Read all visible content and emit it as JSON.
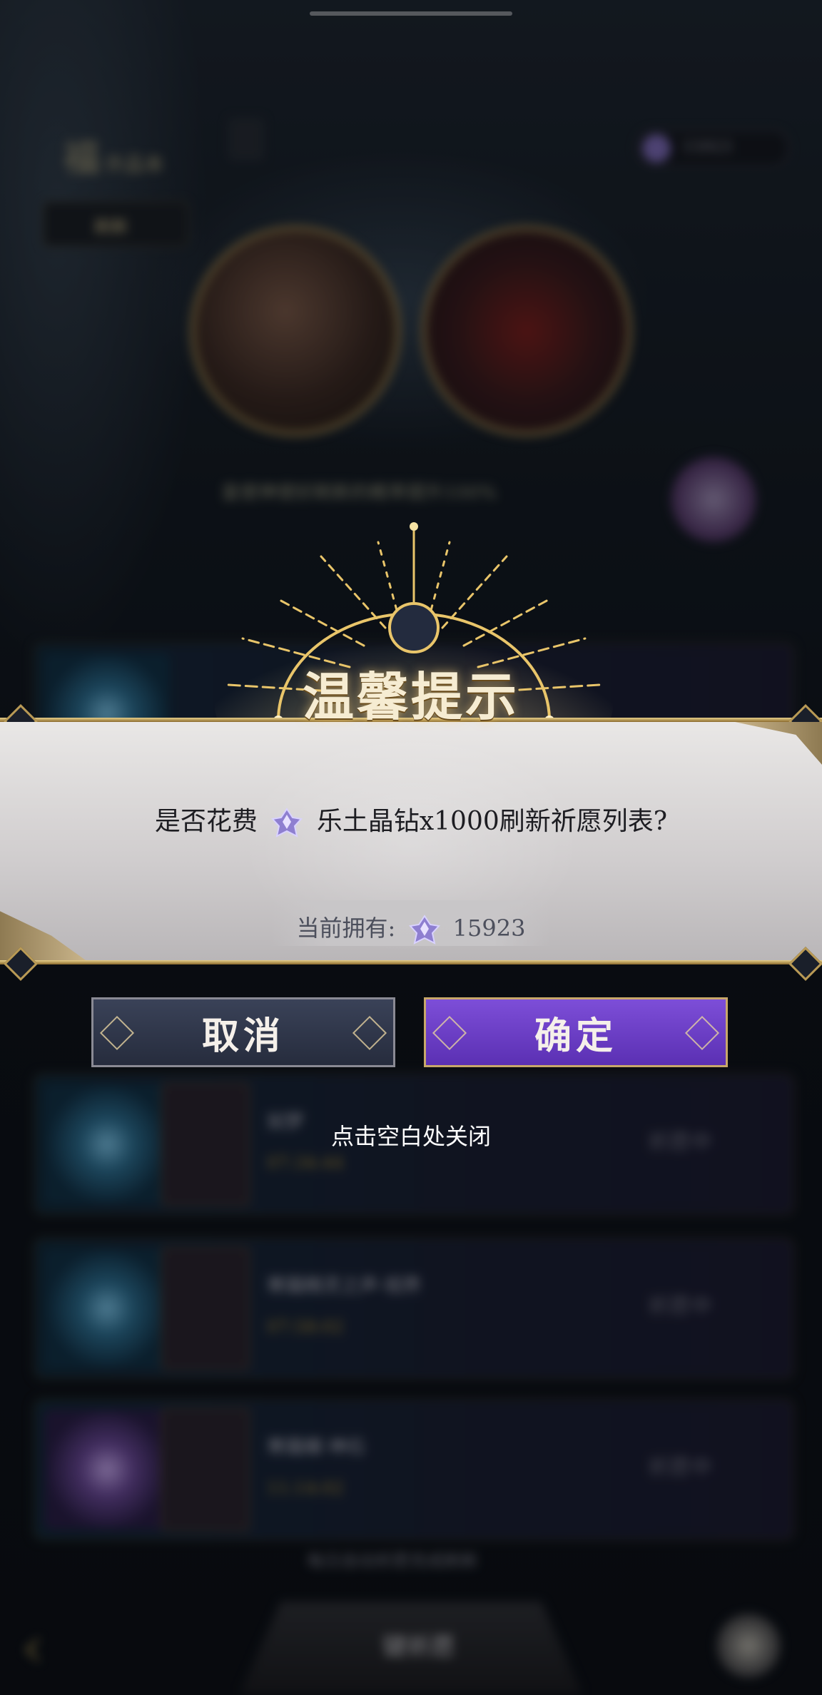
{
  "background": {
    "title": "福",
    "title_suffix": "许品本",
    "currency_value": "15923",
    "tab_label": "刷新",
    "caption": "皇使神使好刷新的概率提升100%",
    "cards": [
      {
        "title": "",
        "timer": "",
        "status": ""
      },
      {
        "title": "如梦",
        "timer": "07:34:44",
        "status": "祈愿中"
      },
      {
        "title": "寒霜精灵之声·视界",
        "timer": "07:58:02",
        "status": "祈愿中"
      },
      {
        "title": "寒霜蝶·神石",
        "timer": "11:14:02",
        "status": "祈愿中"
      }
    ],
    "note": "每日自动祈愿完成刷新",
    "bottom_button": "键祈愿"
  },
  "dialog": {
    "title": "温馨提示",
    "question_prefix": "是否花费",
    "question_suffix": "乐土晶钻x1000刷新祈愿列表?",
    "owned_label": "当前拥有:",
    "owned_value": "15923",
    "cancel_label": "取消",
    "confirm_label": "确定",
    "close_hint": "点击空白处关闭",
    "gem_icon": "crystal-diamond-icon"
  },
  "colors": {
    "title_gold": "#f6ecd2",
    "confirm_purple": "#6a3cc6",
    "cancel_slate": "#2f3649",
    "panel_paper": "#d9d6d7",
    "frame_gold": "#c9a85a"
  }
}
